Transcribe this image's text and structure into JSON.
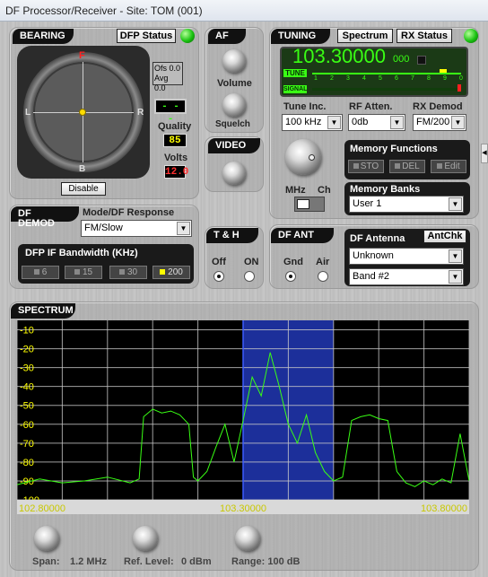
{
  "window": {
    "title": "DF Processor/Receiver - Site: TOM (001)"
  },
  "bearing": {
    "tab": "BEARING",
    "dfp_status_label": "DFP Status",
    "compass": {
      "n": "F",
      "s": "B",
      "e": "R",
      "w": "L"
    },
    "offsets": [
      "Ofs 0.0",
      "Avg 0.0"
    ],
    "bearing_readout": "- - -",
    "quality_label": "Quality",
    "quality_value": "85",
    "volts_label": "Volts",
    "volts_value": "12.0",
    "disable_label": "Disable"
  },
  "af": {
    "tab": "AF",
    "volume_label": "Volume",
    "squelch_label": "Squelch"
  },
  "video": {
    "tab": "VIDEO"
  },
  "tuning": {
    "tab": "TUNING",
    "spectrum_label": "Spectrum",
    "rx_status_label": "RX Status",
    "frequency": "103.30000",
    "frequency_suffix": "000",
    "tune_label": "TUNE",
    "signal_label": "SIGNAL",
    "meter_scale": [
      "1",
      "2",
      "3",
      "4",
      "5",
      "6",
      "7",
      "8",
      "9",
      "0"
    ],
    "tune_inc_label": "Tune Inc.",
    "tune_inc_value": "100 kHz",
    "rf_atten_label": "RF Atten.",
    "rf_atten_value": "0db",
    "rx_demod_label": "RX Demod",
    "rx_demod_value": "FM/200",
    "mhz_label": "MHz",
    "ch_label": "Ch",
    "memory_functions_label": "Memory Functions",
    "mem_buttons": [
      "STO",
      "DEL",
      "Edit"
    ],
    "memory_banks_label": "Memory Banks",
    "memory_bank_value": "User 1"
  },
  "df_demod": {
    "tab": "DF DEMOD",
    "mode_label": "Mode/DF Response",
    "mode_value": "FM/Slow",
    "bw_label": "DFP IF Bandwidth (KHz)",
    "bw_options": [
      "6",
      "15",
      "30",
      "200"
    ]
  },
  "th": {
    "tab": "T & H",
    "off_label": "Off",
    "on_label": "ON"
  },
  "df_ant": {
    "tab": "DF ANT",
    "gnd_label": "Gnd",
    "air_label": "Air",
    "antenna_label": "DF Antenna",
    "antchk_label": "AntChk",
    "antenna_value": "Unknown",
    "band_value": "Band #2"
  },
  "spectrum": {
    "tab": "SPECTRUM",
    "span_label": "Span:",
    "span_value": "1.2 MHz",
    "ref_label": "Ref. Level:",
    "ref_value": "0 dBm",
    "range_label": "Range: 100 dB"
  },
  "colors": {
    "trace": "#39ff14",
    "grid": "#c9c9c9",
    "highlight": "#1c2f9a",
    "accent_yellow": "#ffff00"
  },
  "chart_data": {
    "type": "line",
    "x_tick_labels": [
      "102.80000",
      "103.30000",
      "103.80000"
    ],
    "y_tick_labels": [
      "-10",
      "-20",
      "-30",
      "-40",
      "-50",
      "-60",
      "-70",
      "-80",
      "-90",
      "-100"
    ],
    "xlim": [
      102.8,
      103.8
    ],
    "ylim": [
      -100,
      -5
    ],
    "highlight_band": [
      103.3,
      103.5
    ],
    "series": [
      {
        "x": [
          102.8,
          102.85,
          102.9,
          102.95,
          103.0,
          103.05,
          103.07,
          103.08,
          103.1,
          103.12,
          103.14,
          103.16,
          103.18,
          103.19,
          103.2,
          103.22,
          103.24,
          103.26,
          103.28,
          103.3,
          103.32,
          103.34,
          103.36,
          103.38,
          103.4,
          103.42,
          103.44,
          103.46,
          103.48,
          103.5,
          103.52,
          103.54,
          103.56,
          103.58,
          103.6,
          103.62,
          103.64,
          103.66,
          103.68,
          103.7,
          103.72,
          103.74,
          103.76,
          103.78,
          103.8
        ],
        "y": [
          -92,
          -89,
          -91,
          -90,
          -88,
          -91,
          -89,
          -56,
          -52,
          -54,
          -53,
          -55,
          -60,
          -88,
          -90,
          -85,
          -72,
          -60,
          -80,
          -58,
          -35,
          -45,
          -22,
          -40,
          -60,
          -70,
          -55,
          -75,
          -85,
          -90,
          -88,
          -58,
          -56,
          -55,
          -57,
          -58,
          -85,
          -91,
          -93,
          -90,
          -92,
          -89,
          -91,
          -65,
          -90
        ]
      }
    ]
  }
}
